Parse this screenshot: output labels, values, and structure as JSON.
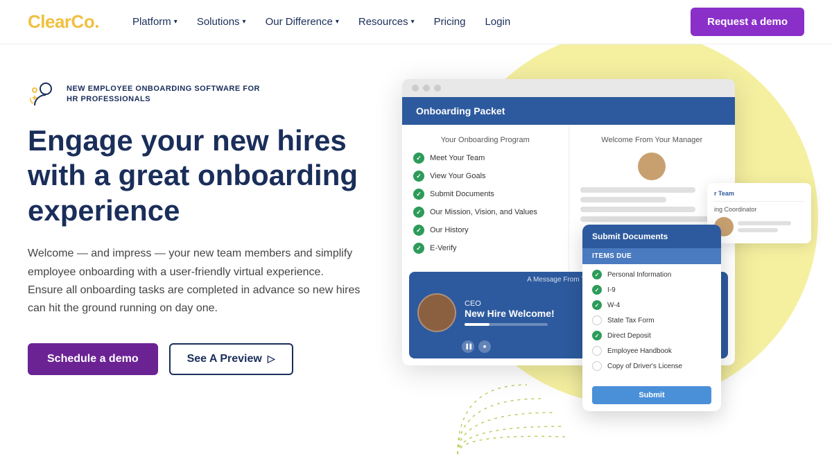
{
  "nav": {
    "logo_text1": "Clear",
    "logo_text2": "Co.",
    "items": [
      {
        "label": "Platform",
        "has_dropdown": true
      },
      {
        "label": "Solutions",
        "has_dropdown": true
      },
      {
        "label": "Our Difference",
        "has_dropdown": true
      },
      {
        "label": "Resources",
        "has_dropdown": true
      },
      {
        "label": "Pricing",
        "has_dropdown": false
      },
      {
        "label": "Login",
        "has_dropdown": false
      }
    ],
    "cta_label": "Request a demo"
  },
  "hero": {
    "badge_text": "NEW EMPLOYEE ONBOARDING SOFTWARE FOR HR PROFESSIONALS",
    "title": "Engage your new hires with a great onboarding experience",
    "description": "Welcome — and impress — your new team members and simplify employee onboarding with a user-friendly virtual experience. Ensure all onboarding tasks are completed in advance so new hires can hit the ground running on day one.",
    "btn_primary": "Schedule a demo",
    "btn_secondary": "See A Preview"
  },
  "mockup": {
    "onboarding_header": "Onboarding Packet",
    "col1_title": "Your Onboarding Program",
    "checklist": [
      "Meet Your Team",
      "View Your Goals",
      "Submit Documents",
      "Our Mission, Vision, and Values",
      "Our History",
      "E-Verify"
    ],
    "col2_title": "Welcome From Your Manager",
    "video": {
      "title_label": "CEO",
      "title": "New Hire Welcome!"
    },
    "submit_card": {
      "header": "Submit Documents",
      "subheader": "Items Due",
      "items": [
        {
          "label": "Personal Information",
          "checked": true
        },
        {
          "label": "I-9",
          "checked": true
        },
        {
          "label": "W-4",
          "checked": true
        },
        {
          "label": "State Tax Form",
          "checked": false
        },
        {
          "label": "Direct Deposit",
          "checked": true
        },
        {
          "label": "Employee Handbook",
          "checked": false
        },
        {
          "label": "Copy of Driver's License",
          "checked": false
        }
      ],
      "btn": "Submit"
    },
    "coord_card": {
      "title": "ing Coordinator"
    }
  }
}
